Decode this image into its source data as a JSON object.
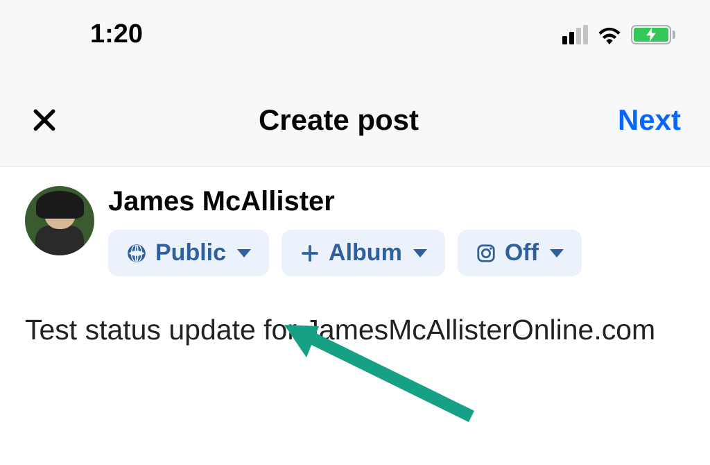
{
  "status_bar": {
    "time": "1:20"
  },
  "header": {
    "title": "Create post",
    "next_label": "Next"
  },
  "user": {
    "name": "James McAllister"
  },
  "chips": {
    "audience": {
      "label": "Public"
    },
    "album": {
      "label": "Album"
    },
    "instagram": {
      "label": "Off"
    }
  },
  "post": {
    "text": "Test status update for JamesMcAllisterOnline.com"
  }
}
